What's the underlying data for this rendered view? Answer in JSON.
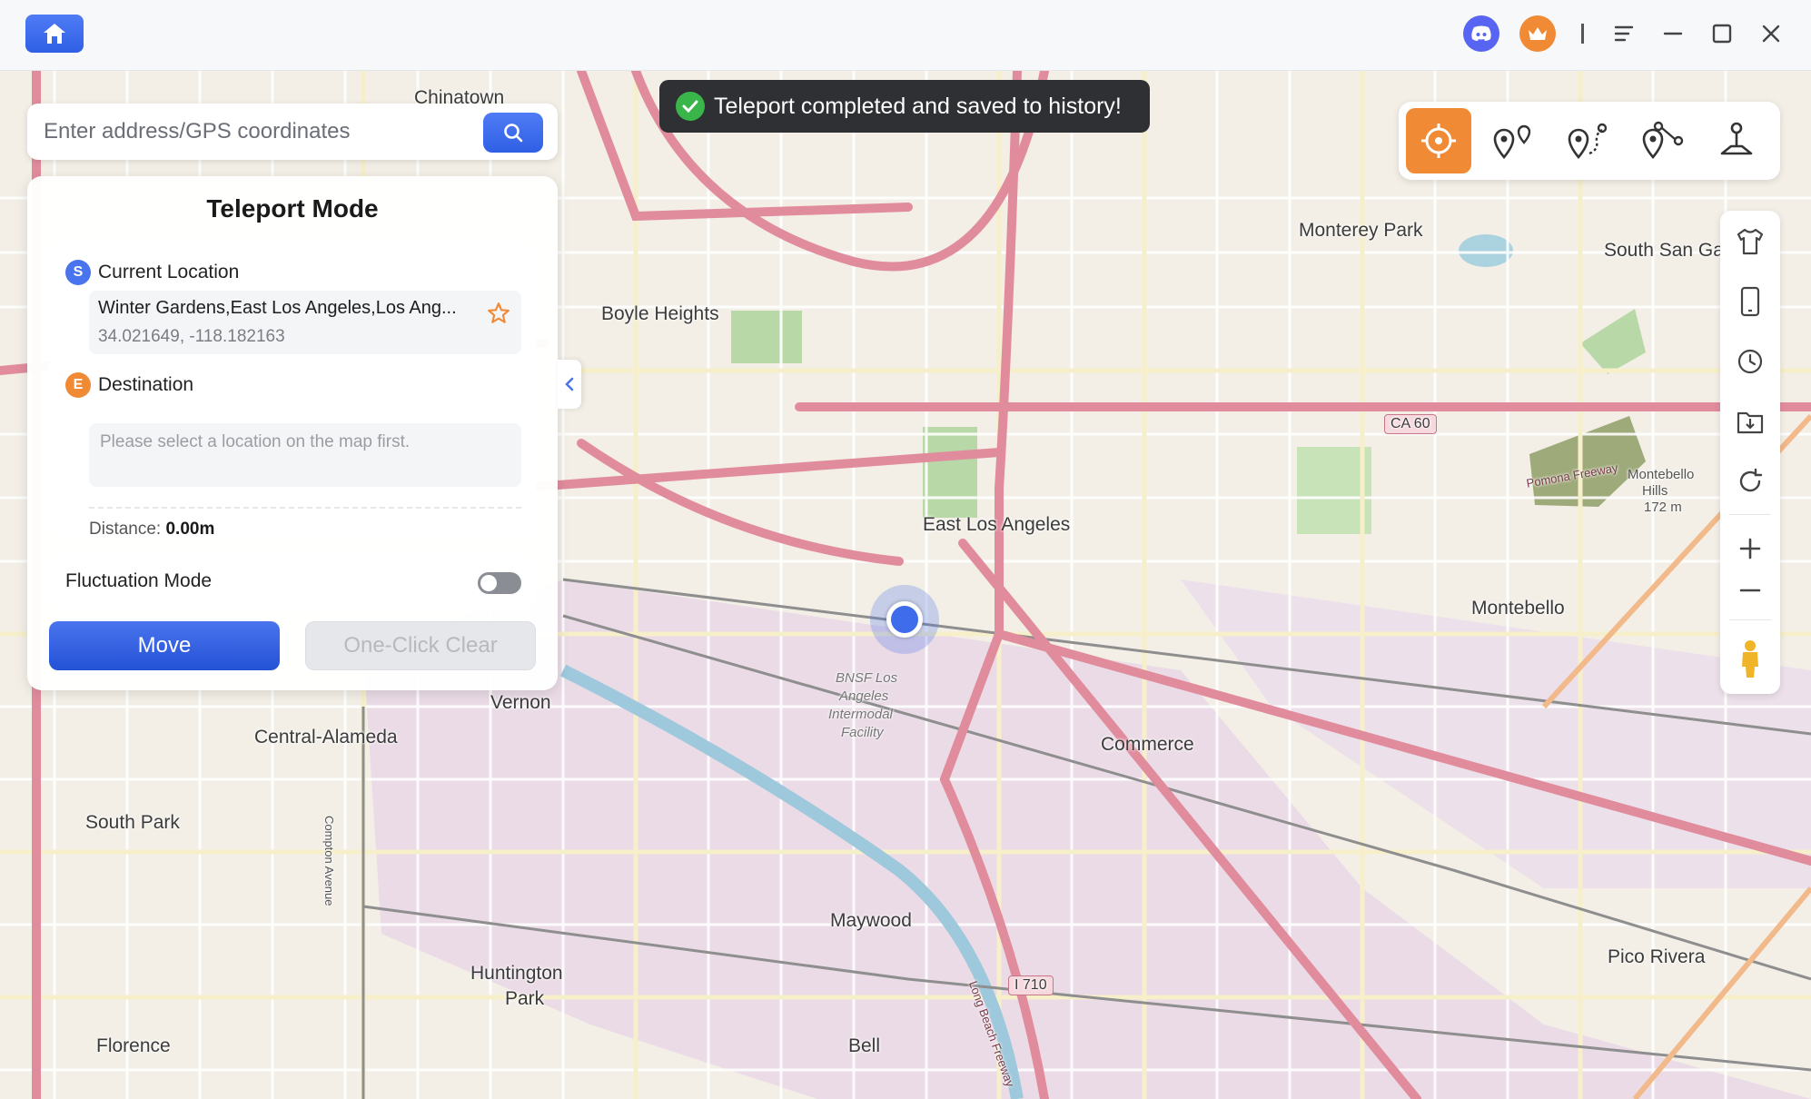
{
  "titlebar": {
    "icons": [
      "home-icon",
      "discord-icon",
      "crown-icon",
      "menu-icon",
      "minimize-icon",
      "maximize-icon",
      "close-icon"
    ]
  },
  "toast": {
    "message": "Teleport completed and saved to history!"
  },
  "search": {
    "placeholder": "Enter address/GPS coordinates",
    "value": ""
  },
  "panel": {
    "title": "Teleport Mode",
    "current": {
      "badge": "S",
      "label": "Current Location",
      "name": "Winter Gardens,East Los Angeles,Los Ang...",
      "coords": "34.021649, -118.182163"
    },
    "destination": {
      "badge": "E",
      "label": "Destination",
      "placeholder": "Please select a location on the map first."
    },
    "distance_label": "Distance:",
    "distance_value": "0.00m",
    "fluctuation_label": "Fluctuation Mode",
    "fluctuation_on": false,
    "move_label": "Move",
    "clear_label": "One-Click Clear"
  },
  "modes": [
    "teleport-mode",
    "two-spot-mode",
    "multi-spot-mode",
    "joystick-route-mode",
    "jump-teleport-mode"
  ],
  "side_tools": [
    "shirt-icon",
    "phone-icon",
    "history-icon",
    "import-icon",
    "reset-icon",
    "zoom-in-icon",
    "zoom-out-icon",
    "pegman-icon"
  ],
  "colors": {
    "accent": "#2f5fe5",
    "active_mode": "#f08a35",
    "toast_bg": "#2e3033"
  },
  "map": {
    "labels": [
      "Chinatown",
      "Monterey Park",
      "South San Ga",
      "Boyle Heights",
      "East Los Angeles",
      "Montebello",
      "Commerce",
      "Vernon",
      "Central-Alameda",
      "South Park",
      "Maywood",
      "Huntington",
      "Park",
      "Florence",
      "Bell",
      "Pico Rivera",
      "CA 60",
      "I 710",
      "Montebello",
      "Hills",
      "172 m",
      "BNSF Los",
      "Angeles",
      "Intermodal",
      "Facility",
      "Pomona Freeway",
      "Long Beach Freeway",
      "Compton Avenue"
    ]
  }
}
